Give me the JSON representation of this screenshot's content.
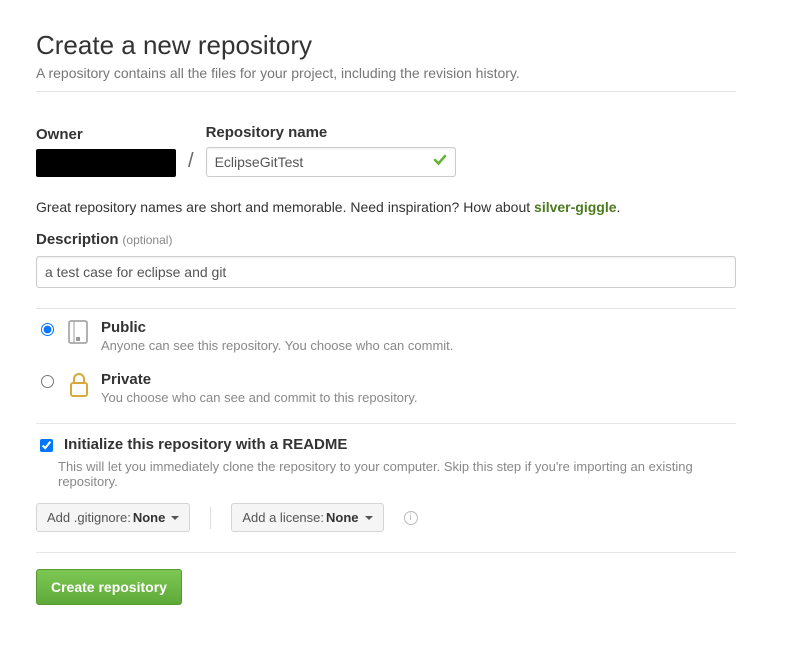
{
  "header": {
    "title": "Create a new repository",
    "subtitle": "A repository contains all the files for your project, including the revision history."
  },
  "owner": {
    "label": "Owner"
  },
  "repo": {
    "label": "Repository name",
    "value": "EclipseGitTest"
  },
  "hint": {
    "text": "Great repository names are short and memorable. Need inspiration? How about ",
    "suggestion": "silver-giggle",
    "suffix": "."
  },
  "description": {
    "label": "Description",
    "optional": "(optional)",
    "value": "a test case for eclipse and git"
  },
  "visibility": {
    "public": {
      "title": "Public",
      "desc": "Anyone can see this repository. You choose who can commit.",
      "checked": true
    },
    "private": {
      "title": "Private",
      "desc": "You choose who can see and commit to this repository.",
      "checked": false
    }
  },
  "readme": {
    "title": "Initialize this repository with a README",
    "desc": "This will let you immediately clone the repository to your computer. Skip this step if you're importing an existing repository.",
    "checked": true
  },
  "dropdowns": {
    "gitignore": {
      "prefix": "Add .gitignore:",
      "value": "None"
    },
    "license": {
      "prefix": "Add a license:",
      "value": "None"
    }
  },
  "submit": {
    "label": "Create repository"
  }
}
